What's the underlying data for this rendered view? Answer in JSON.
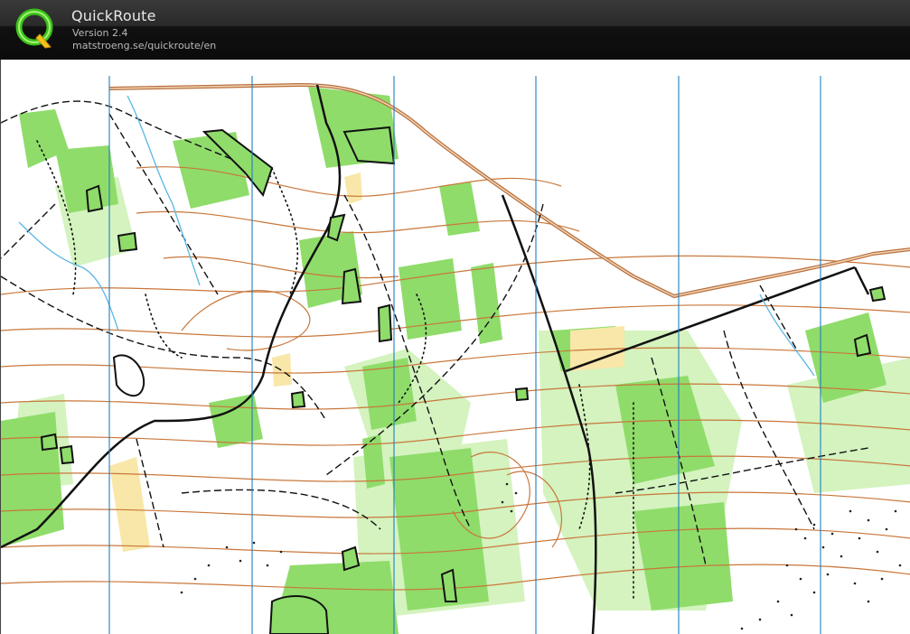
{
  "app": {
    "title": "QuickRoute",
    "version": "Version 2.4",
    "url": "matstroeng.se/quickroute/en"
  },
  "logo": {
    "icon": "quickroute-q-logo-icon",
    "letter": "Q",
    "colors": {
      "ring": "#3cc21a",
      "letter": "#f4c21a"
    }
  },
  "map": {
    "kind": "orienteering-map",
    "colors": {
      "forest_green": "#8fdc6a",
      "light_green": "#c7f0b0",
      "contour_brown": "#c9773b",
      "road_brown": "#b7703f",
      "black_track": "#111111",
      "north_line_blue": "#1e7fc0",
      "yellow_open": "#f8e7a8",
      "water_blue": "#59b6e6"
    }
  }
}
